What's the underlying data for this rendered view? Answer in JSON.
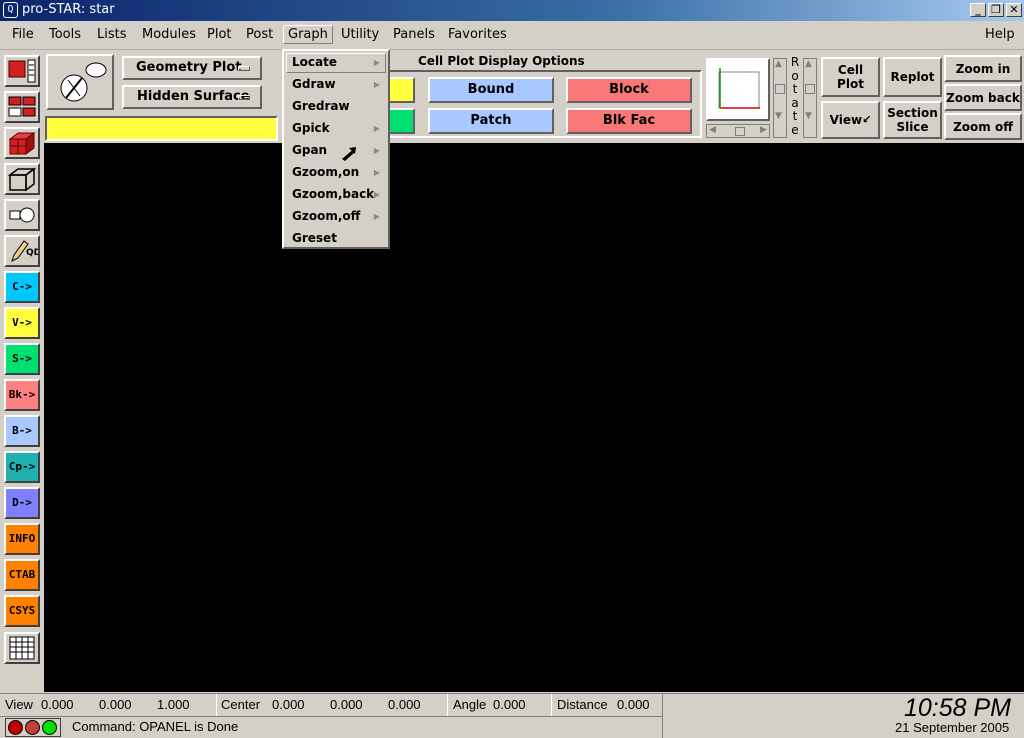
{
  "titlebar": {
    "title": "pro-STAR: star",
    "icon": "prostar-logo-icon",
    "min": "_",
    "max": "❐",
    "close": "✕"
  },
  "menu": {
    "items": [
      "File",
      "Tools",
      "Lists",
      "Modules",
      "Plot",
      "Post",
      "Graph",
      "Utility",
      "Panels",
      "Favorites"
    ],
    "help": "Help"
  },
  "controls": {
    "plot_type": "Geometry Plot",
    "surface_mode": "Hidden Surface",
    "section_title": "Cell Plot Display Options",
    "bound": "Bound",
    "block": "Block",
    "patch": "Patch",
    "blkfac": "Blk Fac",
    "rotate_letters": [
      "R",
      "o",
      "t",
      "a",
      "t",
      "e"
    ],
    "cell_plot": [
      "Cell",
      "Plot"
    ],
    "replot": "Replot",
    "view": "View",
    "section_slice": [
      "Section",
      "Slice"
    ],
    "zoom_in": "Zoom in",
    "zoom_back": "Zoom back",
    "zoom_off": "Zoom off"
  },
  "left_tools": {
    "text_buttons": [
      {
        "label": "C->",
        "color": "#00c8ff"
      },
      {
        "label": "V->",
        "color": "#ffff40"
      },
      {
        "label": "S->",
        "color": "#00e070"
      },
      {
        "label": "Bk->",
        "color": "#ff8080"
      },
      {
        "label": "B->",
        "color": "#a8c8ff"
      },
      {
        "label": "Cp->",
        "color": "#20b0b0"
      },
      {
        "label": "D->",
        "color": "#8080ff"
      },
      {
        "label": "INFO",
        "color": "#ff8000"
      },
      {
        "label": "CTAB",
        "color": "#ff8000"
      },
      {
        "label": "CSYS",
        "color": "#ff8000"
      }
    ],
    "qd": "QD"
  },
  "graph_menu": {
    "items": [
      "Locate",
      "Gdraw",
      "Gredraw",
      "Gpick",
      "Gpan",
      "Gzoom,on",
      "Gzoom,back",
      "Gzoom,off",
      "Greset"
    ],
    "has_submenu": [
      true,
      true,
      false,
      true,
      true,
      true,
      true,
      true,
      false
    ],
    "arrow": "▶"
  },
  "status": {
    "view_label": "View",
    "view_values": [
      "0.000",
      "0.000",
      "1.000"
    ],
    "center_label": "Center",
    "center_values": [
      "0.000",
      "0.000",
      "0.000"
    ],
    "angle_label": "Angle",
    "angle_value": "0.000",
    "distance_label": "Distance",
    "distance_value": "0.000",
    "command": "Command: OPANEL is Done",
    "time": "10:58 PM",
    "date": "21 September 2005",
    "light_colors": [
      "#c00000",
      "#c04040",
      "#00e000"
    ]
  },
  "colors": {
    "yellow": "#ffff40",
    "green": "#00e070",
    "blue_btn": "#a8c8ff",
    "red_btn": "#f87878"
  }
}
